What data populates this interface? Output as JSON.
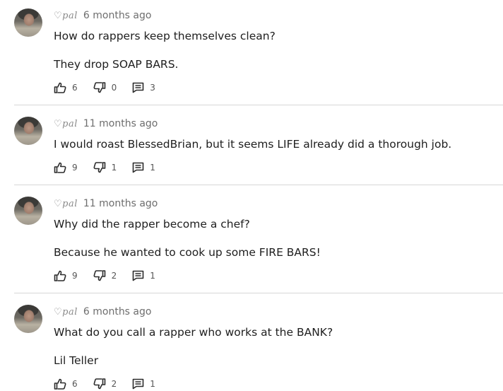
{
  "comments": [
    {
      "username": "♡pal",
      "time": "6 months ago",
      "lines": [
        "How do rappers keep themselves clean?",
        "They drop SOAP BARS."
      ],
      "likes": "6",
      "dislikes": "0",
      "replies": "3"
    },
    {
      "username": "♡pal",
      "time": "11 months ago",
      "lines": [
        "I would roast BlessedBrian, but it seems LIFE already did a thorough job."
      ],
      "likes": "9",
      "dislikes": "1",
      "replies": "1"
    },
    {
      "username": "♡pal",
      "time": "11 months ago",
      "lines": [
        "Why did the rapper become a chef?",
        "Because he wanted to cook up some FIRE BARS!"
      ],
      "likes": "9",
      "dislikes": "2",
      "replies": "1"
    },
    {
      "username": "♡pal",
      "time": "6 months ago",
      "lines": [
        "What do you call a rapper who works at the BANK?",
        "Lil Teller"
      ],
      "likes": "6",
      "dislikes": "2",
      "replies": "1"
    }
  ],
  "icons": {
    "like": "thumbs-up-icon",
    "dislike": "thumbs-down-icon",
    "reply": "comment-icon"
  }
}
